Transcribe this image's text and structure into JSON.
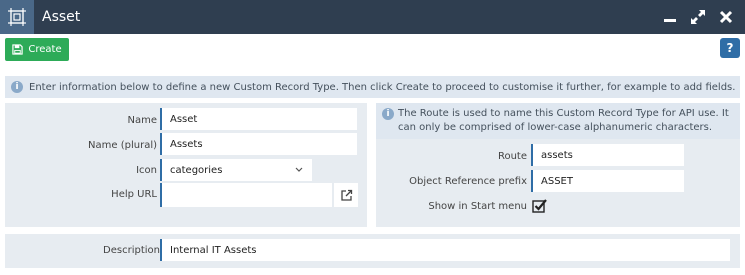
{
  "window": {
    "title": "Asset",
    "app_icon": "custom-record-icon",
    "controls": [
      "minimize-icon",
      "maximize-icon",
      "close-icon"
    ]
  },
  "toolbar": {
    "create_label": "Create",
    "create_icon": "save-icon",
    "help_label": "?"
  },
  "info": {
    "message": "Enter information below to define a new Custom Record Type. Then click Create to proceed to customise it further, for example to add fields."
  },
  "form": {
    "name_label": "Name",
    "name_value": "Asset",
    "plural_label": "Name (plural)",
    "plural_value": "Assets",
    "icon_label": "Icon",
    "icon_value": "categories",
    "help_url_label": "Help URL",
    "help_url_value": "",
    "route_info": "The Route is used to name this Custom Record Type for API use. It can only be comprised of lower-case alphanumeric characters.",
    "route_label": "Route",
    "route_value": "assets",
    "prefix_label": "Object Reference prefix",
    "prefix_value": "ASSET",
    "start_menu_label": "Show in Start menu",
    "start_menu_checked": true,
    "description_label": "Description",
    "description_value": "Internal IT Assets"
  },
  "colors": {
    "titlebar": "#2f3e50",
    "create": "#2dab58",
    "help": "#2f6da6",
    "field_accent": "#2f6da6",
    "panel": "#e7ecf1",
    "info": "#dfe7f0"
  }
}
